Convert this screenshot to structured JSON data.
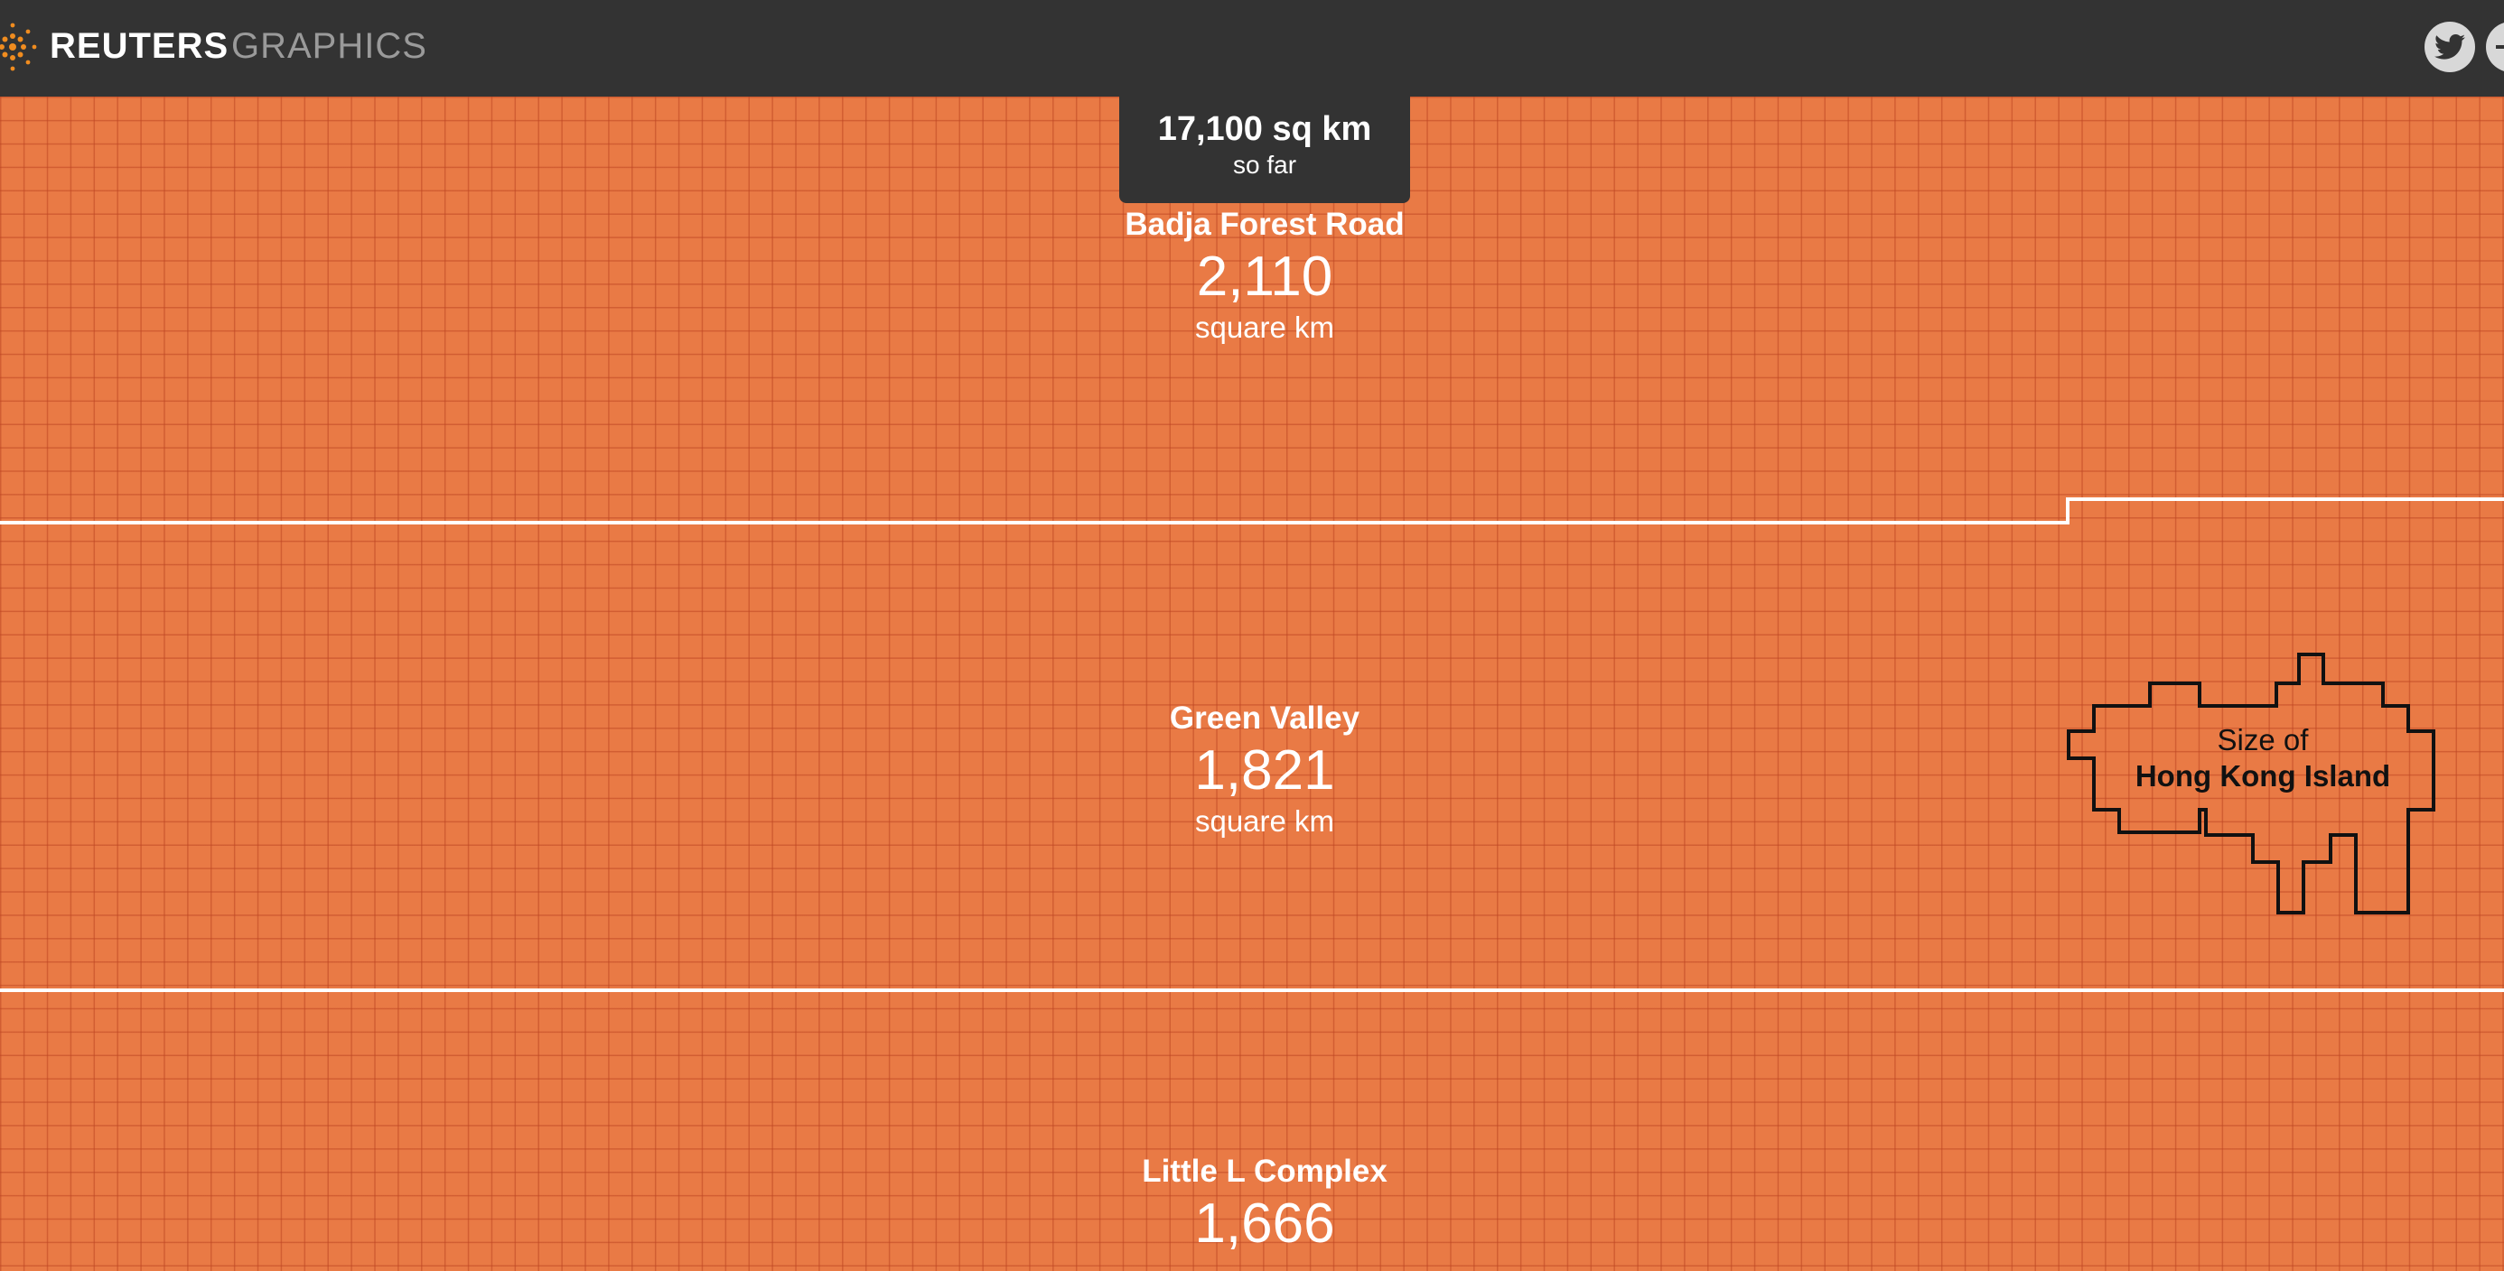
{
  "header": {
    "brand": "REUTERS",
    "section": "GRAPHICS",
    "share_icons": [
      "twitter-icon",
      "share-icon"
    ]
  },
  "running_total": {
    "value": "17,100 sq km",
    "caption": "so far"
  },
  "fires": [
    {
      "name": "Badja Forest Road",
      "area": "2,110",
      "unit": "square km"
    },
    {
      "name": "Green Valley",
      "area": "1,821",
      "unit": "square km"
    },
    {
      "name": "Little L Complex",
      "area": "1,666",
      "unit": ""
    }
  ],
  "reference": {
    "line1": "Size of",
    "line2": "Hong Kong Island"
  },
  "colors": {
    "fire_fill": "#e97a45",
    "grid_line": "#c0502a",
    "header_bg": "#333333",
    "boundary": "#ffffff",
    "outline": "#111111"
  }
}
